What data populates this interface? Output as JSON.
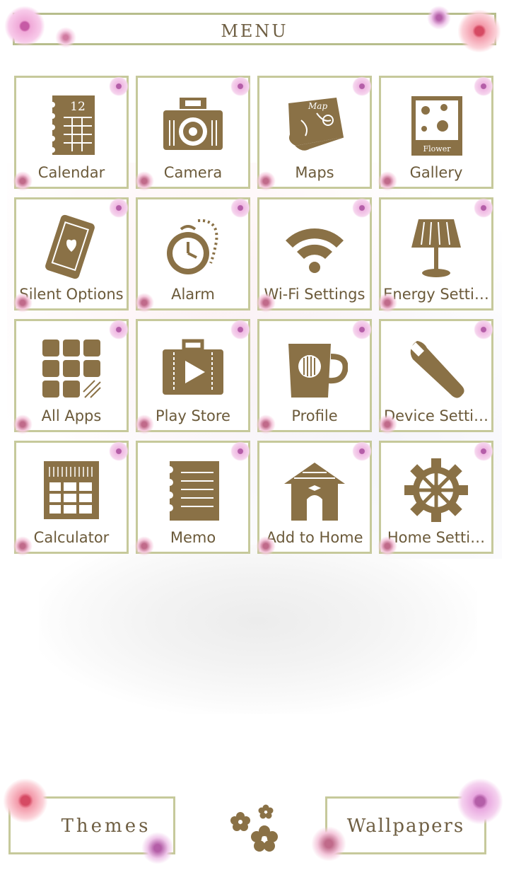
{
  "menu": {
    "title": "MENU"
  },
  "tiles": [
    {
      "label": "Calendar",
      "icon": "calendar-icon",
      "badge": "12"
    },
    {
      "label": "Camera",
      "icon": "camera-icon"
    },
    {
      "label": "Maps",
      "icon": "map-icon",
      "badge": "Map"
    },
    {
      "label": "Gallery",
      "icon": "gallery-icon",
      "badge": "Flower"
    },
    {
      "label": "Silent Options",
      "icon": "phone-heart-icon"
    },
    {
      "label": "Alarm",
      "icon": "alarm-clock-icon"
    },
    {
      "label": "Wi-Fi Settings",
      "icon": "wifi-icon"
    },
    {
      "label": "Energy Setti…",
      "icon": "lamp-icon"
    },
    {
      "label": "All Apps",
      "icon": "grid-icon"
    },
    {
      "label": "Play Store",
      "icon": "suitcase-play-icon"
    },
    {
      "label": "Profile",
      "icon": "mug-icon"
    },
    {
      "label": "Device Setti…",
      "icon": "wrench-icon"
    },
    {
      "label": "Calculator",
      "icon": "calculator-icon"
    },
    {
      "label": "Memo",
      "icon": "notebook-icon"
    },
    {
      "label": "Add to Home",
      "icon": "house-icon"
    },
    {
      "label": "Home Setti…",
      "icon": "gear-icon"
    }
  ],
  "bottom": {
    "themes": "Themes",
    "wallpapers": "Wallpapers"
  },
  "colors": {
    "icon": "#8a7146",
    "border": "#c6c99b",
    "text": "#6b5a3a",
    "accent_pink": "#efb8e2"
  }
}
